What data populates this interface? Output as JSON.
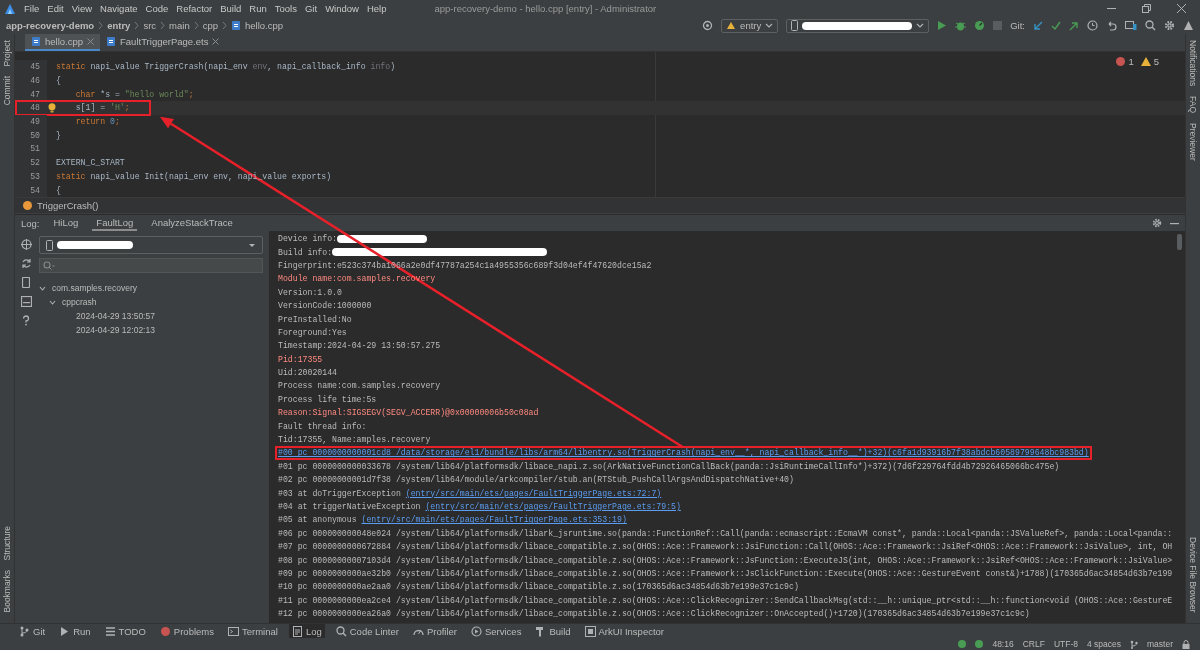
{
  "window": {
    "title": "app-recovery-demo - hello.cpp [entry] - Administrator"
  },
  "menu": [
    "File",
    "Edit",
    "View",
    "Navigate",
    "Code",
    "Refactor",
    "Build",
    "Run",
    "Tools",
    "Git",
    "Window",
    "Help"
  ],
  "breadcrumb": [
    {
      "label": "app-recovery-demo",
      "kind": "project"
    },
    {
      "label": "entry",
      "kind": "module"
    },
    {
      "label": "src",
      "kind": "folder"
    },
    {
      "label": "main",
      "kind": "folder"
    },
    {
      "label": "cpp",
      "kind": "folder"
    },
    {
      "label": "hello.cpp",
      "kind": "file"
    }
  ],
  "toolbar": {
    "run_config": "entry",
    "vcs_label": "Git:"
  },
  "editor_tabs": [
    {
      "label": "hello.cpp",
      "selected": true
    },
    {
      "label": "FaultTriggerPage.ets",
      "selected": false
    }
  ],
  "inspections": {
    "errors": "1",
    "warnings": "5"
  },
  "code_lines": [
    {
      "number": "45",
      "tokens": [
        {
          "text": "static ",
          "kind": "keyword"
        },
        {
          "text": "napi_value TriggerCrash(napi_env ",
          "kind": "plain"
        },
        {
          "text": "env",
          "kind": "param"
        },
        {
          "text": ", napi_callback_info ",
          "kind": "plain"
        },
        {
          "text": "info",
          "kind": "param"
        },
        {
          "text": ")",
          "kind": "plain"
        }
      ]
    },
    {
      "number": "46",
      "tokens": [
        {
          "text": "{",
          "kind": "plain"
        }
      ]
    },
    {
      "number": "47",
      "tokens": [
        {
          "text": "    char",
          "kind": "keyword"
        },
        {
          "text": " *s = ",
          "kind": "plain"
        },
        {
          "text": "\"hello world\"",
          "kind": "string"
        },
        {
          "text": ";",
          "kind": "keyword"
        }
      ]
    },
    {
      "number": "48",
      "current": true,
      "annotated": true,
      "tokens": [
        {
          "text": "    s[1] = ",
          "kind": "plain"
        },
        {
          "text": "'H'",
          "kind": "string"
        },
        {
          "text": ";",
          "kind": "keyword"
        }
      ]
    },
    {
      "number": "49",
      "tokens": [
        {
          "text": "    return ",
          "kind": "keyword"
        },
        {
          "text": "0",
          "kind": "number"
        },
        {
          "text": ";",
          "kind": "keyword"
        }
      ]
    },
    {
      "number": "50",
      "tokens": [
        {
          "text": "}",
          "kind": "plain"
        }
      ]
    },
    {
      "number": "51"
    },
    {
      "number": "52",
      "tokens": [
        {
          "text": "EXTERN_C_START",
          "kind": "plain"
        }
      ]
    },
    {
      "number": "53",
      "tokens": [
        {
          "text": "static ",
          "kind": "keyword"
        },
        {
          "text": "napi_value Init(napi_env env, napi_value exports)",
          "kind": "plain"
        }
      ]
    },
    {
      "number": "54",
      "tokens": [
        {
          "text": "{",
          "kind": "plain"
        }
      ]
    }
  ],
  "code_breadcrumb": "TriggerCrash()",
  "log_panel": {
    "label": "Log:",
    "tabs": [
      {
        "label": "HiLog",
        "selected": false
      },
      {
        "label": "FaultLog",
        "selected": true
      },
      {
        "label": "AnalyzeStackTrace",
        "selected": false
      }
    ],
    "tree": [
      {
        "label": "com.samples.recovery",
        "expanded": true,
        "selected": false,
        "children": [
          {
            "label": "cppcrash",
            "expanded": true,
            "selected": false,
            "children": [
              {
                "label": "2024-04-29 13:50:57",
                "selected": false
              },
              {
                "label": "2024-04-29 12:02:13",
                "selected": false
              }
            ]
          }
        ]
      }
    ],
    "lines": [
      {
        "kind": "info",
        "text": "Device info:",
        "redacted": true
      },
      {
        "kind": "info",
        "text": "Build info:",
        "redacted": true
      },
      {
        "kind": "info",
        "text": "Fingerprint:e523c374ba1066a2e0df47787a254c1a4955356c689f3d04ef4f47620dce15a2"
      },
      {
        "kind": "error",
        "text": "Module name:com.samples.recovery"
      },
      {
        "kind": "info",
        "text": "Version:1.0.0"
      },
      {
        "kind": "info",
        "text": "VersionCode:1000000"
      },
      {
        "kind": "info",
        "text": "PreInstalled:No"
      },
      {
        "kind": "info",
        "text": "Foreground:Yes"
      },
      {
        "kind": "info",
        "text": "Timestamp:2024-04-29 13:50:57.275"
      },
      {
        "kind": "error",
        "text": "Pid:17355"
      },
      {
        "kind": "info",
        "text": "Uid:20020144"
      },
      {
        "kind": "info",
        "text": "Process name:com.samples.recovery"
      },
      {
        "kind": "info",
        "text": "Process life time:5s"
      },
      {
        "kind": "error",
        "text": "Reason:Signal:SIGSEGV(SEGV_ACCERR)@0x00000006b50c08ad"
      },
      {
        "kind": "info",
        "text": "Fault thread info:"
      },
      {
        "kind": "info",
        "text": "Tid:17355, Name:amples.recovery"
      },
      {
        "kind": "info",
        "link": "#00 pc 0000000000001cd8 /data/storage/el1/bundle/libs/arm64/libentry.so(TriggerCrash(napi_env__*, napi_callback_info__*)+32)(c6fa1d93916b7f38abdcb60589799648bc983bd)",
        "annotated": true
      },
      {
        "kind": "info",
        "text": "#01 pc 0000000000033678 /system/lib64/platformsdk/libace_napi.z.so(ArkNativeFunctionCallBack(panda::JsiRuntimeCallInfo*)+372)(7d6f229764fdd4b72926465066bc475e)"
      },
      {
        "kind": "info",
        "text": "#02 pc 00000000001d7f38 /system/lib64/module/arkcompiler/stub.an(RTStub_PushCallArgsAndDispatchNative+40)"
      },
      {
        "kind": "info",
        "text": "#03 at doTriggerException ",
        "link": "(entry/src/main/ets/pages/FaultTriggerPage.ets:72:7)"
      },
      {
        "kind": "info",
        "text": "#04 at triggerNativeException ",
        "link": "(entry/src/main/ets/pages/FaultTriggerPage.ets:79:5)"
      },
      {
        "kind": "info",
        "text": "#05 at anonymous ",
        "link": "(entry/src/main/ets/pages/FaultTriggerPage.ets:353:19)"
      },
      {
        "kind": "info",
        "text": "#06 pc 000000000048e024 /system/lib64/platformsdk/libark_jsruntime.so(panda::FunctionRef::Call(panda::ecmascript::EcmaVM const*, panda::Local<panda::JSValueRef>, panda::Local<panda::"
      },
      {
        "kind": "info",
        "text": "#07 pc 0000000000672884 /system/lib64/platformsdk/libace_compatible.z.so(OHOS::Ace::Framework::JsiFunction::Call(OHOS::Ace::Framework::JsiRef<OHOS::Ace::Framework::JsiValue>, int, OH"
      },
      {
        "kind": "info",
        "text": "#08 pc 00000000007103d4 /system/lib64/platformsdk/libace_compatible.z.so(OHOS::Ace::Framework::JsFunction::ExecuteJS(int, OHOS::Ace::Framework::JsiRef<OHOS::Ace::Framework::JsiValue>"
      },
      {
        "kind": "info",
        "text": "#09 pc 0000000000ae32b0 /system/lib64/platformsdk/libace_compatible.z.so(OHOS::Ace::Framework::JsClickFunction::Execute(OHOS::Ace::GestureEvent const&)+1788)(170365d6ac34854d63b7e199"
      },
      {
        "kind": "info",
        "text": "#10 pc 0000000000ae2aa0 /system/lib64/platformsdk/libace_compatible.z.so(170365d6ac34854d63b7e199e37c1c9c)"
      },
      {
        "kind": "info",
        "text": "#11 pc 0000000000ea2ce4 /system/lib64/platformsdk/libace_compatible.z.so(OHOS::Ace::ClickRecognizer::SendCallbackMsg(std::__h::unique_ptr<std::__h::function<void (OHOS::Ace::GestureE"
      },
      {
        "kind": "info",
        "text": "#12 pc 0000000000ea26a0 /system/lib64/platformsdk/libace_compatible.z.so(OHOS::Ace::ClickRecognizer::OnAccepted()+1720)(170365d6ac34854d63b7e199e37c1c9c)"
      }
    ]
  },
  "left_strip": {
    "top": [
      "Project",
      "Commit"
    ],
    "bottom": [
      "Structure",
      "Bookmarks"
    ]
  },
  "right_strip": {
    "top": [
      "Notifications",
      "FAQ",
      "Previewer"
    ],
    "bottom": [
      "Device File Browser"
    ]
  },
  "tool_windows": [
    {
      "label": "Git",
      "selected": false
    },
    {
      "label": "Run",
      "selected": false
    },
    {
      "label": "TODO",
      "selected": false
    },
    {
      "label": "Problems",
      "selected": false
    },
    {
      "label": "Terminal",
      "selected": false
    },
    {
      "label": "Log",
      "selected": true
    },
    {
      "label": "Code Linter",
      "selected": false
    },
    {
      "label": "Profiler",
      "selected": false
    },
    {
      "label": "Services",
      "selected": false
    },
    {
      "label": "Build",
      "selected": false
    },
    {
      "label": "ArkUI Inspector",
      "selected": false
    }
  ],
  "status": {
    "position": "48:16",
    "line_separator": "CRLF",
    "encoding": "UTF-8",
    "indent": "4 spaces",
    "branch": "master"
  }
}
